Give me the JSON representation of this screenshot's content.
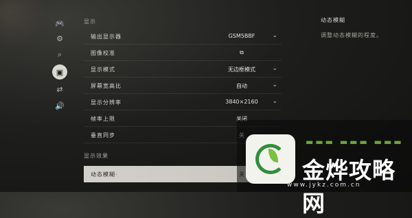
{
  "sidebar": {
    "icons": [
      {
        "name": "gamepad-icon",
        "glyph": "🎮"
      },
      {
        "name": "settings-icon",
        "glyph": "⚙"
      },
      {
        "name": "search-icon",
        "glyph": "⌕"
      },
      {
        "name": "monitor-icon",
        "glyph": "▣",
        "active": true
      },
      {
        "name": "swap-icon",
        "glyph": "⇄"
      },
      {
        "name": "audio-icon",
        "glyph": "🔊"
      }
    ]
  },
  "sections": {
    "display": "显示",
    "display_effects": "显示效果"
  },
  "settings": [
    {
      "label": "输出显示器",
      "value": "GSM5BBF",
      "chevron": true
    },
    {
      "label": "图像校准",
      "value": "⧉",
      "chevron": false
    },
    {
      "label": "显示模式",
      "value": "无边框模式",
      "chevron": true
    },
    {
      "label": "屏幕宽高比",
      "value": "自动",
      "chevron": true
    },
    {
      "label": "显示分辨率",
      "value": "3840×2160",
      "chevron": true
    },
    {
      "label": "帧率上限",
      "value": "关闭",
      "chevron": false
    },
    {
      "label": "垂直同步",
      "value": "关",
      "chevron": false
    }
  ],
  "effects": [
    {
      "label": "动态模糊·",
      "value": "关",
      "chevron": false
    }
  ],
  "description": {
    "title": "动态模糊",
    "text": "调整动态模糊的程度。"
  },
  "watermark": {
    "title": "金烨攻略网",
    "url": "www.jykz.com.cn"
  },
  "colors": {
    "highlight": "#d2d0ca",
    "watermark_green": "#2f8e3a"
  }
}
